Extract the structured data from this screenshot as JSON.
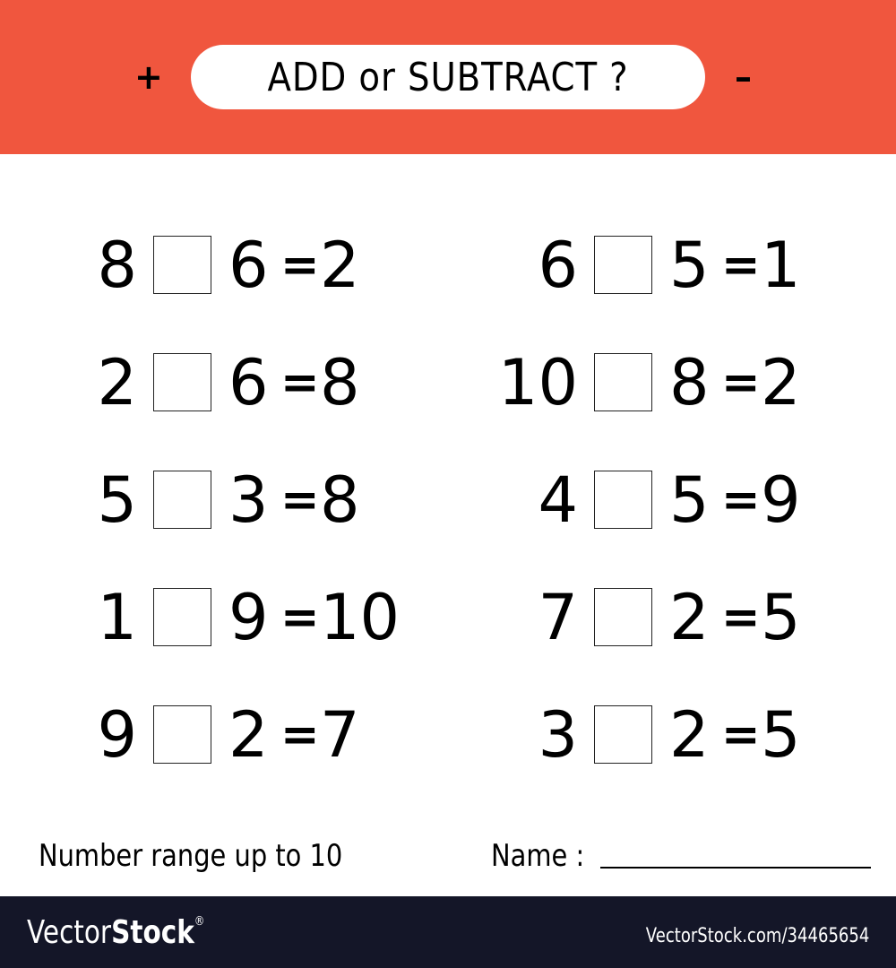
{
  "colors": {
    "header_bg": "#F0563E",
    "footer_bg": "#141628"
  },
  "header": {
    "title": "ADD or SUBTRACT ?",
    "left_symbol": "+",
    "right_symbol": "–"
  },
  "problems": [
    {
      "a": "8",
      "b": "6",
      "eq": "=",
      "result": "2"
    },
    {
      "a": "2",
      "b": "6",
      "eq": "=",
      "result": "8"
    },
    {
      "a": "5",
      "b": "3",
      "eq": "=",
      "result": "8"
    },
    {
      "a": "1",
      "b": "9",
      "eq": "=",
      "result": "10"
    },
    {
      "a": "9",
      "b": "2",
      "eq": "=",
      "result": "7"
    },
    {
      "a": "6",
      "b": "5",
      "eq": "=",
      "result": "1"
    },
    {
      "a": "10",
      "b": "8",
      "eq": "=",
      "result": "2"
    },
    {
      "a": "4",
      "b": "5",
      "eq": "=",
      "result": "9"
    },
    {
      "a": "7",
      "b": "2",
      "eq": "=",
      "result": "5"
    },
    {
      "a": "3",
      "b": "2",
      "eq": "=",
      "result": "5"
    }
  ],
  "footer_text": {
    "range": "Number range up to 10",
    "name_label": "Name :"
  },
  "watermark": {
    "logo_light": "Vector",
    "logo_bold": "Stock",
    "registered": "®",
    "url": "VectorStock.com/34465654"
  }
}
